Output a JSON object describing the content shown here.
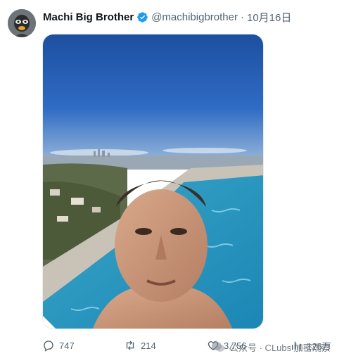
{
  "author": {
    "display_name": "Machi Big Brother",
    "handle": "@machibigbrother",
    "separator": "·",
    "date": "10月16日",
    "verified_color": "#1d9bf0"
  },
  "media": {
    "icon": "photo"
  },
  "actions": {
    "replies": "747",
    "retweets": "214",
    "likes": "3,756",
    "views": "126万"
  },
  "watermark": {
    "text": "公众号 · CLubs 加密观察"
  },
  "colors": {
    "text_primary": "#0f1419",
    "text_secondary": "#536471",
    "accent": "#1d9bf0"
  }
}
